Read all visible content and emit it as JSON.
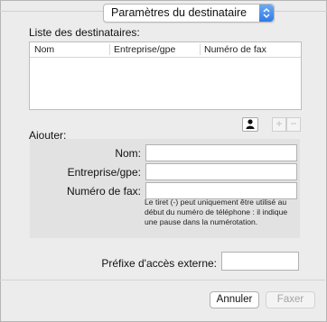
{
  "header": {
    "popup_value": "Paramètres du destinataire"
  },
  "recipients": {
    "section_label": "Liste des destinataires:",
    "columns": [
      "Nom",
      "Entreprise/gpe",
      "Numéro de fax"
    ]
  },
  "toolbar": {
    "add_symbol": "+",
    "remove_symbol": "−",
    "address_book_icon": "person-icon"
  },
  "add_section": {
    "label": "Ajouter:",
    "name_label": "Nom:",
    "company_label": "Entreprise/gpe:",
    "fax_label": "Numéro de fax:",
    "name_value": "",
    "company_value": "",
    "fax_value": "",
    "hint": "Le tiret (-) peut uniquement être utilisé au début du numéro de téléphone : il indique une pause dans la numérotation."
  },
  "prefix": {
    "label": "Préfixe d'accès externe:",
    "value": ""
  },
  "buttons": {
    "cancel": "Annuler",
    "fax": "Faxer"
  },
  "colors": {
    "popup_arrow": "#2f79e6",
    "window_bg": "#ececec",
    "panel_bg": "#e2e2e2"
  }
}
